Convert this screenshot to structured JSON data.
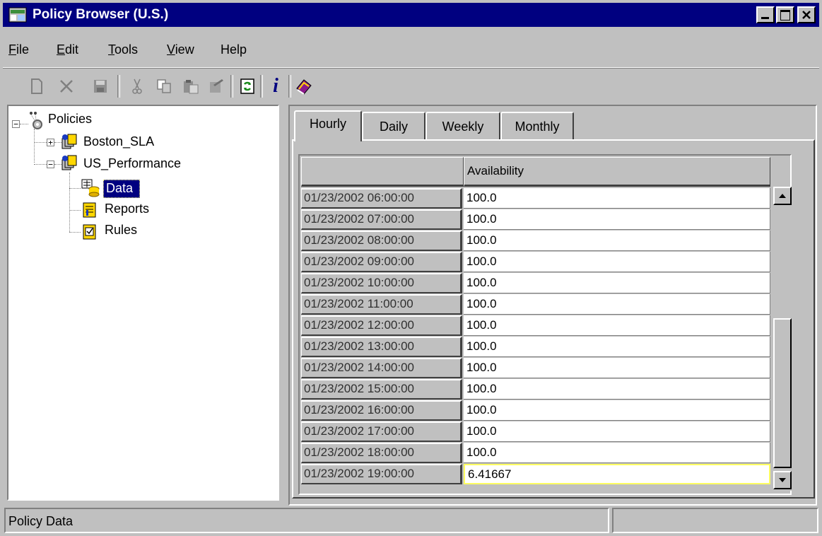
{
  "window": {
    "title": "Policy Browser (U.S.)"
  },
  "menu": {
    "items": [
      {
        "label": "File",
        "underline": "F",
        "rest": "ile"
      },
      {
        "label": "Edit",
        "underline": "E",
        "rest": "dit"
      },
      {
        "label": "Tools",
        "underline": "T",
        "rest": "ools"
      },
      {
        "label": "View",
        "underline": "V",
        "rest": "iew"
      },
      {
        "label": "Help",
        "underline": "",
        "rest": "Help"
      }
    ]
  },
  "toolbar": {
    "icons": [
      "new-icon",
      "delete-icon",
      "save-icon",
      "cut-icon",
      "copy-icon",
      "paste-icon",
      "properties-icon",
      "refresh-icon",
      "info-icon",
      "help-book-icon"
    ],
    "disabled": [
      "new-icon",
      "delete-icon",
      "save-icon",
      "cut-icon",
      "copy-icon",
      "paste-icon",
      "properties-icon"
    ]
  },
  "tree": {
    "root": "Policies",
    "policies": [
      "Boston_SLA",
      "US_Performance"
    ],
    "children": [
      "Data",
      "Reports",
      "Rules"
    ],
    "selected": "Data"
  },
  "tabs": [
    "Hourly",
    "Daily",
    "Weekly",
    "Monthly"
  ],
  "active_tab": "Hourly",
  "table": {
    "column_header": "Availability",
    "rows": [
      {
        "time": "01/23/2002 06:00:00",
        "value": "100.0"
      },
      {
        "time": "01/23/2002 07:00:00",
        "value": "100.0"
      },
      {
        "time": "01/23/2002 08:00:00",
        "value": "100.0"
      },
      {
        "time": "01/23/2002 09:00:00",
        "value": "100.0"
      },
      {
        "time": "01/23/2002 10:00:00",
        "value": "100.0"
      },
      {
        "time": "01/23/2002 11:00:00",
        "value": "100.0"
      },
      {
        "time": "01/23/2002 12:00:00",
        "value": "100.0"
      },
      {
        "time": "01/23/2002 13:00:00",
        "value": "100.0"
      },
      {
        "time": "01/23/2002 14:00:00",
        "value": "100.0"
      },
      {
        "time": "01/23/2002 15:00:00",
        "value": "100.0"
      },
      {
        "time": "01/23/2002 16:00:00",
        "value": "100.0"
      },
      {
        "time": "01/23/2002 17:00:00",
        "value": "100.0"
      },
      {
        "time": "01/23/2002 18:00:00",
        "value": "100.0"
      },
      {
        "time": "01/23/2002 19:00:00",
        "value": "6.41667"
      }
    ],
    "selected_row": 13
  },
  "status": {
    "text": "Policy Data"
  },
  "colors": {
    "titlebar": "#000080",
    "selection": "#000080",
    "face": "#c0c0c0",
    "cell_focus": "#ffff60"
  }
}
